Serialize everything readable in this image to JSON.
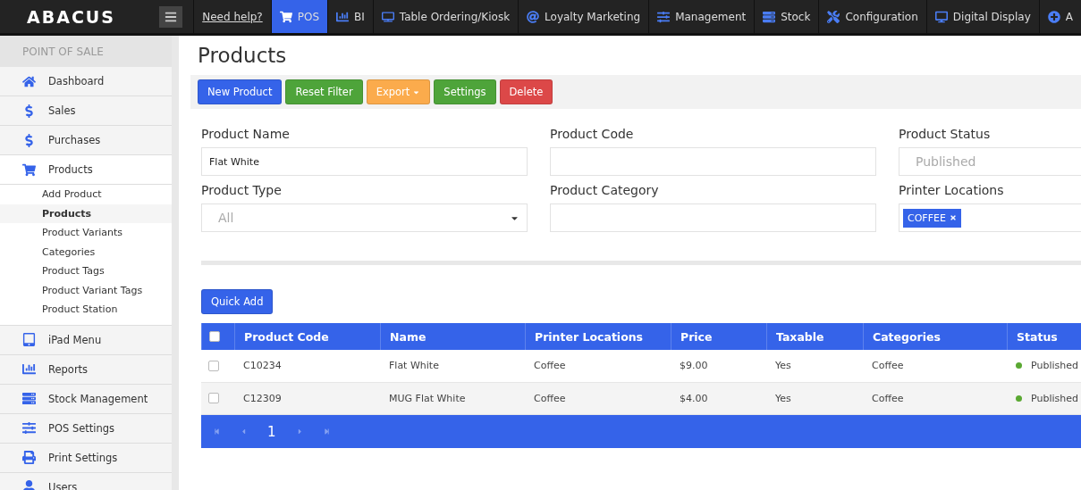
{
  "brand": "ABACUS",
  "top_nav": [
    {
      "label": "Need help?",
      "kind": "link",
      "selected": false
    },
    {
      "label": "POS",
      "kind": "cart",
      "selected": true
    },
    {
      "label": "BI",
      "kind": "chart",
      "selected": false
    },
    {
      "label": "Table Ordering/Kiosk",
      "kind": "tv",
      "selected": false
    },
    {
      "label": "Loyalty Marketing",
      "kind": "at",
      "selected": false
    },
    {
      "label": "Management",
      "kind": "sliders",
      "selected": false
    },
    {
      "label": "Stock",
      "kind": "stack",
      "selected": false
    },
    {
      "label": "Configuration",
      "kind": "tools",
      "selected": false
    },
    {
      "label": "Digital Display",
      "kind": "desktop",
      "selected": false
    },
    {
      "label": "A",
      "kind": "plus",
      "selected": false
    }
  ],
  "sidebar": {
    "heading": "POINT OF SALE",
    "items": [
      {
        "label": "Dashboard",
        "kind": "home"
      },
      {
        "label": "Sales",
        "kind": "dollar"
      },
      {
        "label": "Purchases",
        "kind": "dollar"
      },
      {
        "label": "Products",
        "kind": "cart",
        "children": [
          {
            "label": "Add Product",
            "selected": false
          },
          {
            "label": "Products",
            "selected": true
          },
          {
            "label": "Product Variants",
            "selected": false
          },
          {
            "label": "Categories",
            "selected": false
          },
          {
            "label": "Product Tags",
            "selected": false
          },
          {
            "label": "Product Variant Tags",
            "selected": false
          },
          {
            "label": "Product Station",
            "selected": false
          }
        ]
      },
      {
        "label": "iPad Menu",
        "kind": "tablet"
      },
      {
        "label": "Reports",
        "kind": "chart"
      },
      {
        "label": "Stock Management",
        "kind": "stack"
      },
      {
        "label": "POS Settings",
        "kind": "sliders"
      },
      {
        "label": "Print Settings",
        "kind": "print"
      },
      {
        "label": "Users",
        "kind": "user"
      }
    ]
  },
  "page_title": "Products",
  "toolbar": [
    {
      "label": "New Product",
      "kind": "primary",
      "dropdown": false
    },
    {
      "label": "Reset Filter",
      "kind": "success",
      "dropdown": false
    },
    {
      "label": "Export",
      "kind": "warning",
      "dropdown": true
    },
    {
      "label": "Settings",
      "kind": "success",
      "dropdown": false
    },
    {
      "label": "Delete",
      "kind": "danger",
      "dropdown": false
    }
  ],
  "filters": [
    {
      "label": "Product Name",
      "kind": "text",
      "value": "Flat White"
    },
    {
      "label": "Product Code",
      "kind": "text"
    },
    {
      "label": "Product Status",
      "kind": "text",
      "placeholder": "Published"
    },
    {
      "label": "Product Type",
      "kind": "select",
      "placeholder": "All"
    },
    {
      "label": "Product Category",
      "kind": "text"
    },
    {
      "label": "Printer Locations",
      "kind": "tags",
      "tags": [
        "COFFEE"
      ]
    }
  ],
  "quick_add": "Quick Add",
  "table": {
    "all_checked": false,
    "columns": [
      "Product Code",
      "Name",
      "Printer Locations",
      "Price",
      "Taxable",
      "Categories",
      "Status"
    ],
    "rows": [
      {
        "checked": false,
        "cells": [
          "C10234",
          "Flat White",
          "Coffee",
          "$9.00",
          "Yes",
          "Coffee"
        ],
        "status": "Published",
        "color": "#5aa832"
      },
      {
        "checked": false,
        "cells": [
          "C12309",
          "MUG Flat White",
          "Coffee",
          "$4.00",
          "Yes",
          "Coffee"
        ],
        "status": "Published",
        "color": "#5aa832"
      }
    ],
    "pagination": {
      "page": "1"
    }
  }
}
